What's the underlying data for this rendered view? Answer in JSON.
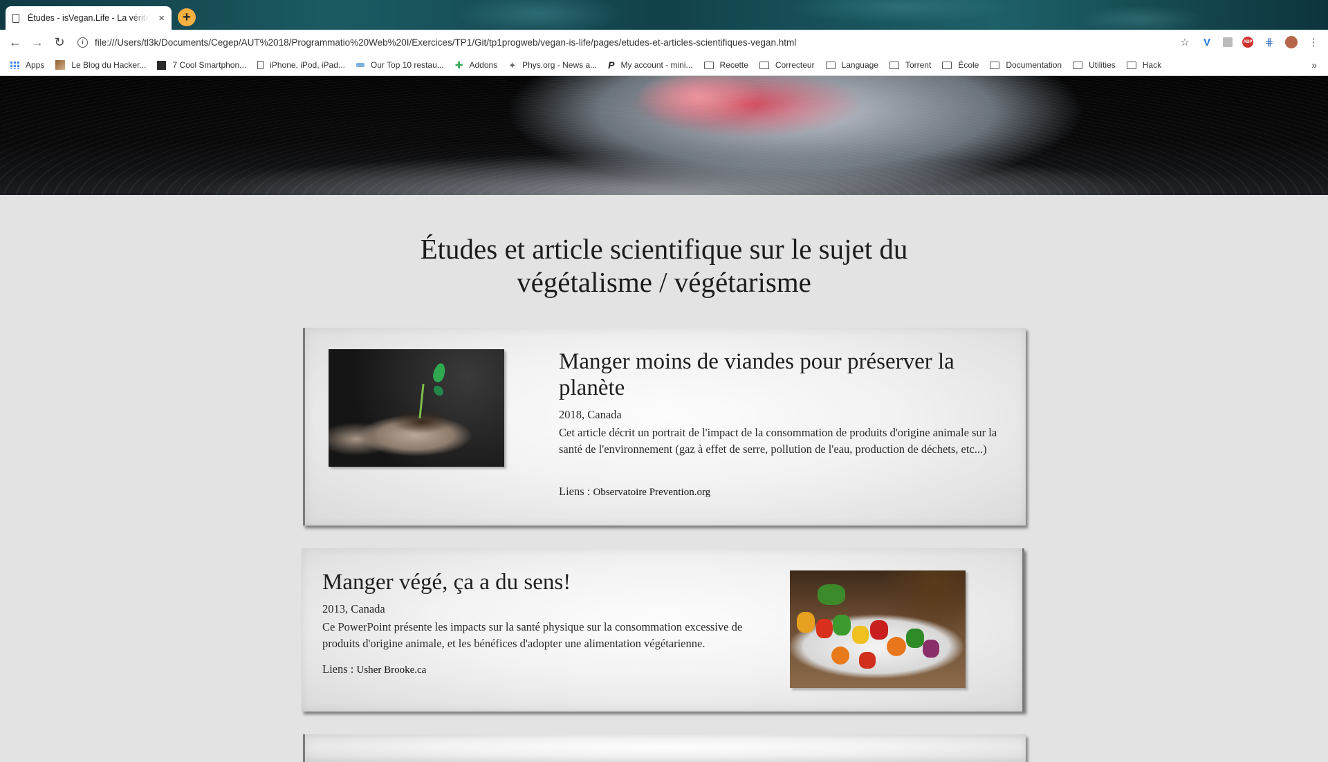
{
  "browser": {
    "tab_title": "Études - isVegan.Life - La vérité",
    "tab_close": "×",
    "new_tab": "+",
    "nav": {
      "back": "←",
      "forward": "→",
      "reload": "↻"
    },
    "url": "file:///Users/tl3k/Documents/Cegep/AUT%2018/Programmatio%20Web%20I/Exercices/TP1/Git/tp1progweb/vegan-is-life/pages/etudes-et-articles-scientifiques-vegan.html",
    "info_icon": "i",
    "star": "☆",
    "menu": "⋮",
    "extensions": {
      "v": "V",
      "grid": "⋕",
      "abp": "ABP"
    },
    "bookmarks": [
      {
        "label": "Apps",
        "icon": "apps-icon"
      },
      {
        "label": "Le Blog du Hacker...",
        "icon": "image-icon"
      },
      {
        "label": "7 Cool Smartphon...",
        "icon": "dark-square-icon"
      },
      {
        "label": "iPhone, iPod, iPad...",
        "icon": "page-icon"
      },
      {
        "label": "Our Top 10 restau...",
        "icon": "blue-icon"
      },
      {
        "label": "Addons",
        "icon": "puzzle-icon"
      },
      {
        "label": "Phys.org - News a...",
        "icon": "atom-icon"
      },
      {
        "label": "My account - mini...",
        "icon": "p-icon"
      },
      {
        "label": "Recette",
        "icon": "folder-icon"
      },
      {
        "label": "Correcteur",
        "icon": "folder-icon"
      },
      {
        "label": "Language",
        "icon": "folder-icon"
      },
      {
        "label": "Torrent",
        "icon": "folder-icon"
      },
      {
        "label": "École",
        "icon": "folder-icon"
      },
      {
        "label": "Documentation",
        "icon": "folder-icon"
      },
      {
        "label": "Utilities",
        "icon": "folder-icon"
      },
      {
        "label": "Hack",
        "icon": "folder-icon"
      }
    ],
    "bookmarks_more": "»"
  },
  "page": {
    "title_line1": "Études et article scientifique sur le sujet du",
    "title_line2": "végétalisme / végétarisme",
    "articles": [
      {
        "title": "Manger moins de viandes pour préserver la planète",
        "meta": "2018, Canada",
        "description": "Cet article décrit un portrait de l'impact de la consommation de produits d'origine animale sur la santé de l'environnement (gaz à effet de serre, pollution de l'eau, production de déchets, etc...)",
        "links_label": "Liens : ",
        "link_text": "Observatoire Prevention.org",
        "image": "seedling-in-hands"
      },
      {
        "title": "Manger végé, ça a du sens!",
        "meta": "2013, Canada",
        "description": "Ce PowerPoint présente les impacts sur la santé physique sur la consommation excessive de produits d'origine animale, et les bénéfices d'adopter une alimentation végétarienne.",
        "links_label": "Liens : ",
        "link_text": "Usher Brooke.ca",
        "image": "vegetable-skewers"
      }
    ]
  }
}
